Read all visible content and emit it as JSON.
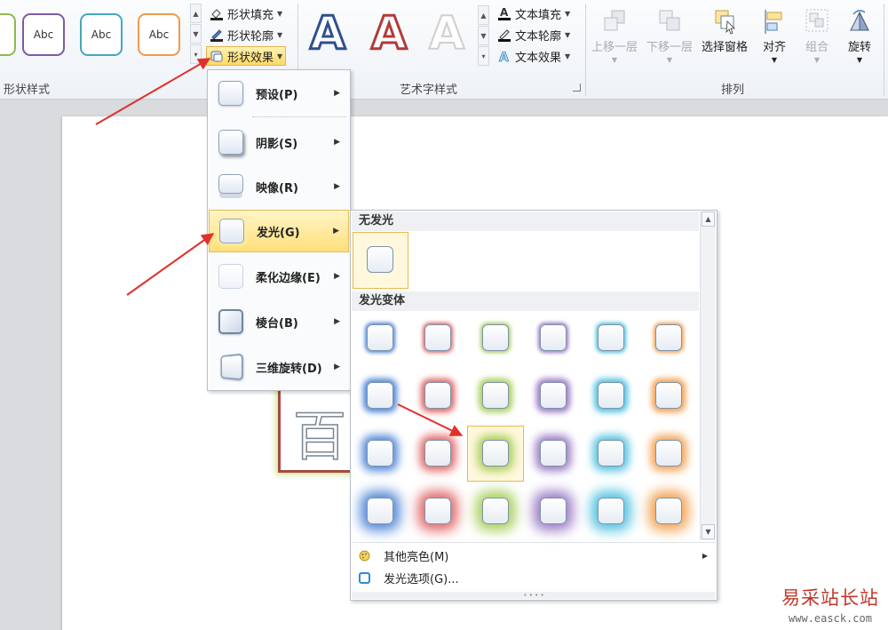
{
  "ribbon": {
    "shape_styles": {
      "group_label": "形状样式",
      "thumbs": [
        {
          "label": "",
          "border": "#8dbb4f"
        },
        {
          "label": "Abc",
          "border": "#7d5aa6"
        },
        {
          "label": "Abc",
          "border": "#45a7bd"
        },
        {
          "label": "Abc",
          "border": "#ef9a4a"
        }
      ],
      "fill_label": "形状填充",
      "outline_label": "形状轮廓",
      "effects_label": "形状效果"
    },
    "wordart_styles": {
      "group_label": "艺术字样式",
      "samples": [
        {
          "letter": "A",
          "fill": "#ffffff",
          "stroke": "#2f4f8e"
        },
        {
          "letter": "A",
          "fill": "#ffffff",
          "stroke": "#b23a3a"
        },
        {
          "letter": "A",
          "fill": "#ffffff",
          "stroke": "#cfcfcf"
        }
      ],
      "text_fill_label": "文本填充",
      "text_outline_label": "文本轮廓",
      "text_effects_label": "文本效果"
    },
    "arrange": {
      "group_label": "排列",
      "bring_forward": "上移一层",
      "send_backward": "下移一层",
      "selection_pane": "选择窗格",
      "align": "对齐",
      "group": "组合",
      "rotate": "旋转"
    }
  },
  "slide": {
    "shape_char": "百"
  },
  "effects_menu": {
    "items": [
      {
        "label": "预设(P)"
      },
      {
        "label": "阴影(S)"
      },
      {
        "label": "映像(R)"
      },
      {
        "label": "发光(G)"
      },
      {
        "label": "柔化边缘(E)"
      },
      {
        "label": "棱台(B)"
      },
      {
        "label": "三维旋转(D)"
      }
    ]
  },
  "glow_submenu": {
    "no_glow_heading": "无发光",
    "variants_heading": "发光变体",
    "glow_colors": [
      "#4f86d6",
      "#e06666",
      "#a8cf5a",
      "#9a7ac4",
      "#4fc1e0",
      "#f2a252"
    ],
    "rows": 4,
    "selected": {
      "row": 2,
      "col": 2
    },
    "more_colors_label": "其他亮色(M)",
    "glow_options_label": "发光选项(G)..."
  },
  "watermark": {
    "line1": "易采站长站",
    "line2": "www.easck.com"
  }
}
